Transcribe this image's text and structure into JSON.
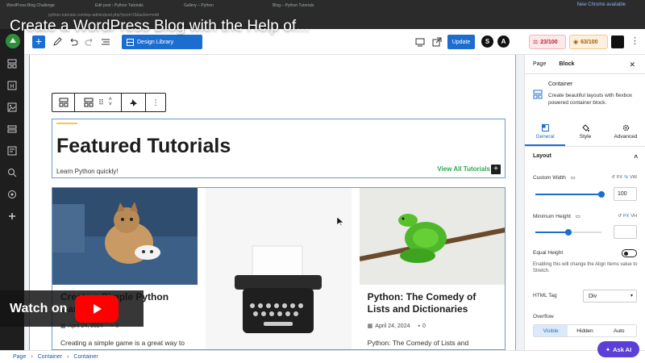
{
  "video": {
    "title": "Create a WordPress Blog with the Help of...",
    "watch_label": "Watch on",
    "youtube_logo": "youtube-logo"
  },
  "browser": {
    "tabs": [
      "WordPress Blog Challenge",
      "Edit post ‹ Python Tutorials",
      "Gallery – Python",
      "Blog – Python Tutorials"
    ],
    "new_chrome": "New Chrome available",
    "url": "python-tutorials.com/wp-admin/post.php?post=16&action=edit"
  },
  "toolbar": {
    "design_library": "Design Library",
    "update": "Update",
    "seo_score": "23/100",
    "readability_score": "63/100",
    "badge_s": "S",
    "badge_a": "A"
  },
  "canvas": {
    "heading": "Featured Tutorials",
    "subheading": "Learn Python quickly!",
    "view_all": "View All Tutorials",
    "cards": [
      {
        "title": "Create a Simple Python Game",
        "date": "April 24, 2024",
        "comments": "0",
        "excerpt": "Creating a simple game is a great way to learn Python programming."
      },
      {
        "title": "",
        "date": "",
        "comments": "",
        "excerpt": ""
      },
      {
        "title": "Python: The Comedy of Lists and Dictionaries",
        "date": "April 24, 2024",
        "comments": "0",
        "excerpt": "Python: The Comedy of Lists and Dictionaries. Python, the language of"
      }
    ]
  },
  "panel": {
    "tabs": [
      "Page",
      "Block"
    ],
    "block_name": "Container",
    "block_desc": "Create beautiful layouts with flexbox powered container block.",
    "settings_tabs": [
      "General",
      "Style",
      "Advanced"
    ],
    "section": "Layout",
    "custom_width_label": "Custom Width",
    "custom_width_units": [
      "PX",
      "%",
      "VW"
    ],
    "custom_width_value": "100",
    "custom_width_fraction": 1.0,
    "min_height_label": "Minimum Height",
    "min_height_units": [
      "PX",
      "VH"
    ],
    "min_height_value": "",
    "min_height_fraction": 0.5,
    "equal_height_label": "Equal Height",
    "equal_height_help": "Enabling this will change the Align Items value to Stretch.",
    "html_tag_label": "HTML Tag",
    "html_tag_value": "Div",
    "overflow_label": "Overflow",
    "overflow_options": [
      "Visible",
      "Hidden",
      "Auto"
    ]
  },
  "breadcrumb": [
    "Page",
    "Container",
    "Container"
  ],
  "ask_ai": "Ask AI",
  "colors": {
    "accent": "#1c6dd0",
    "green_link": "#2fa84f",
    "seo_red": "#b91c2c",
    "read_orange": "#a45a00",
    "ask_ai_purple": "#5b3fd6"
  }
}
